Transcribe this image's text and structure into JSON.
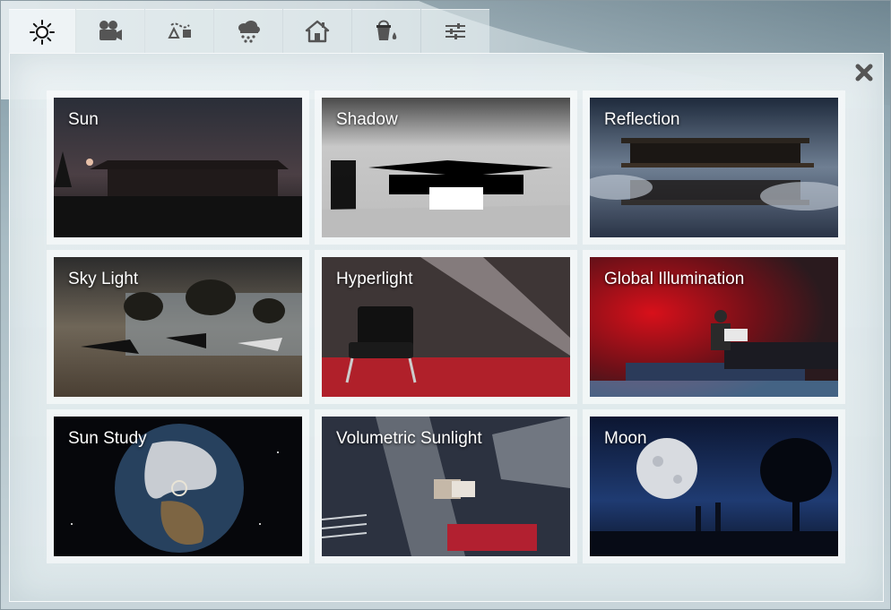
{
  "toolbar": {
    "tabs": [
      {
        "id": "sun",
        "icon": "sun-icon",
        "active": true
      },
      {
        "id": "camera",
        "icon": "video-camera-icon",
        "active": false
      },
      {
        "id": "path",
        "icon": "path-shapes-icon",
        "active": false
      },
      {
        "id": "weather",
        "icon": "cloud-snow-icon",
        "active": false
      },
      {
        "id": "house",
        "icon": "house-icon",
        "active": false
      },
      {
        "id": "paint",
        "icon": "paint-bucket-icon",
        "active": false
      },
      {
        "id": "settings",
        "icon": "sliders-icon",
        "active": false
      }
    ]
  },
  "dialog": {
    "close_icon": "close-icon",
    "effects": [
      {
        "label": "Sun"
      },
      {
        "label": "Shadow"
      },
      {
        "label": "Reflection"
      },
      {
        "label": "Sky Light"
      },
      {
        "label": "Hyperlight"
      },
      {
        "label": "Global Illumination"
      },
      {
        "label": "Sun Study"
      },
      {
        "label": "Volumetric Sunlight"
      },
      {
        "label": "Moon"
      }
    ]
  }
}
